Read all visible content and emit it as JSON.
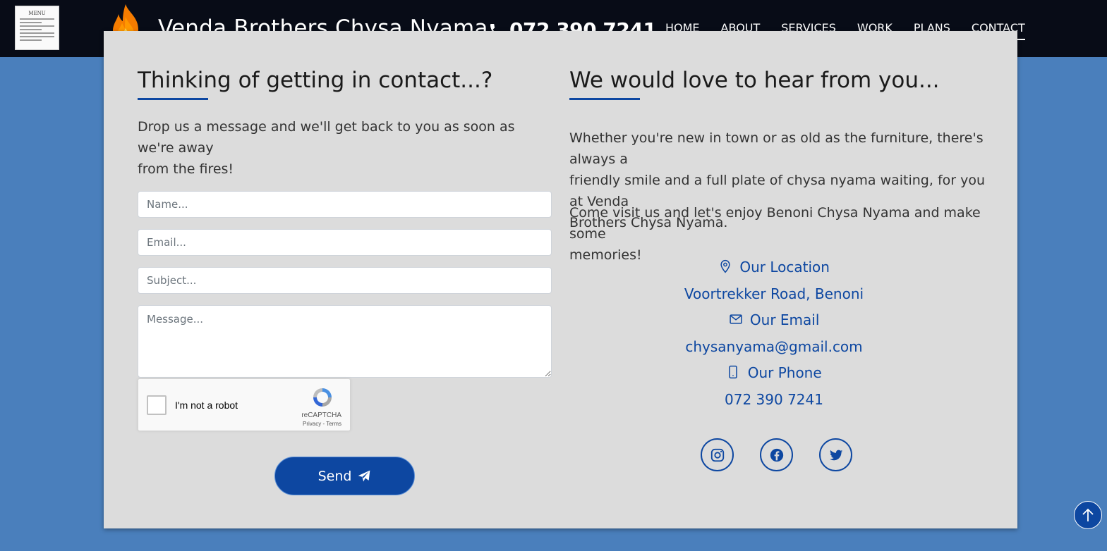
{
  "header": {
    "brand": "Venda Brothers Chysa Nyama",
    "phone": "072 390 7241",
    "menu_thumbnail_title": "MENU",
    "nav": [
      "HOME",
      "ABOUT",
      "SERVICES",
      "WORK",
      "PLANS",
      "CONTACT"
    ],
    "active_nav": "CONTACT"
  },
  "left": {
    "heading": "Thinking of getting in contact...?",
    "intro_line1": "Drop us a message and we'll get back to you as soon as we're away",
    "intro_line2": "from the fires!",
    "form": {
      "name_placeholder": "Name...",
      "email_placeholder": "Email...",
      "subject_placeholder": "Subject...",
      "message_placeholder": "Message..."
    },
    "recaptcha": {
      "label": "I'm not a robot",
      "brand": "reCAPTCHA",
      "privacy": "Privacy",
      "separator": " - ",
      "terms": "Terms"
    },
    "send_label": "Send"
  },
  "right": {
    "heading": "We would love to hear from you...",
    "para1_line1": "Whether you're new in town or as old as the furniture, there's always a",
    "para1_line2": "friendly smile and a full plate of chysa nyama waiting, for you at Venda",
    "para1_line3": "Brothers Chysa Nyama.",
    "para2_line1": "Come visit us and let's enjoy Benoni Chysa Nyama and make some",
    "para2_line2": "memories!",
    "location_label": "Our Location",
    "location_value": "Voortrekker Road, Benoni",
    "email_label": "Our Email",
    "email_value": "chysanyama@gmail.com",
    "phone_label": "Our Phone",
    "phone_value": "072 390 7241"
  },
  "colors": {
    "accent": "#0d47a1",
    "page_background": "#4a7fbc",
    "card_background": "#dcdcdc",
    "topbar": "#080c17"
  },
  "icons": {
    "social": [
      "instagram-icon",
      "facebook-icon",
      "twitter-icon"
    ]
  }
}
